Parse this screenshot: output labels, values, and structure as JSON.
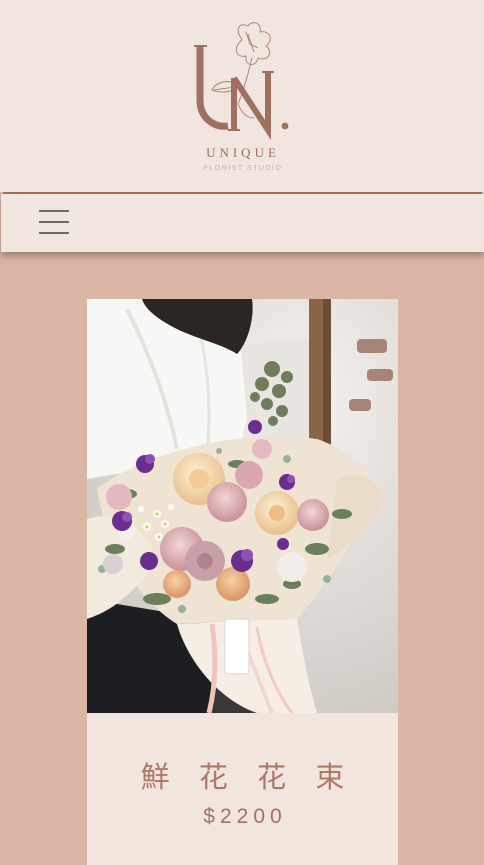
{
  "brand": {
    "name": "UNIQUE",
    "tagline": "FLORIST STUDIO",
    "monogram": "UN.",
    "logo_color": "#9f6f5f"
  },
  "nav": {
    "menu_icon": "hamburger-menu-icon"
  },
  "product": {
    "name": "鮮 花 花 束",
    "price": "$2200",
    "image_description_icon": "flower-bouquet-photo"
  },
  "colors": {
    "header_bg": "#f1e6df",
    "page_bg": "#dcb6a5",
    "divider": "#a96d5e",
    "card_bg": "#f2e5de",
    "accent_text": "#ad786a"
  }
}
